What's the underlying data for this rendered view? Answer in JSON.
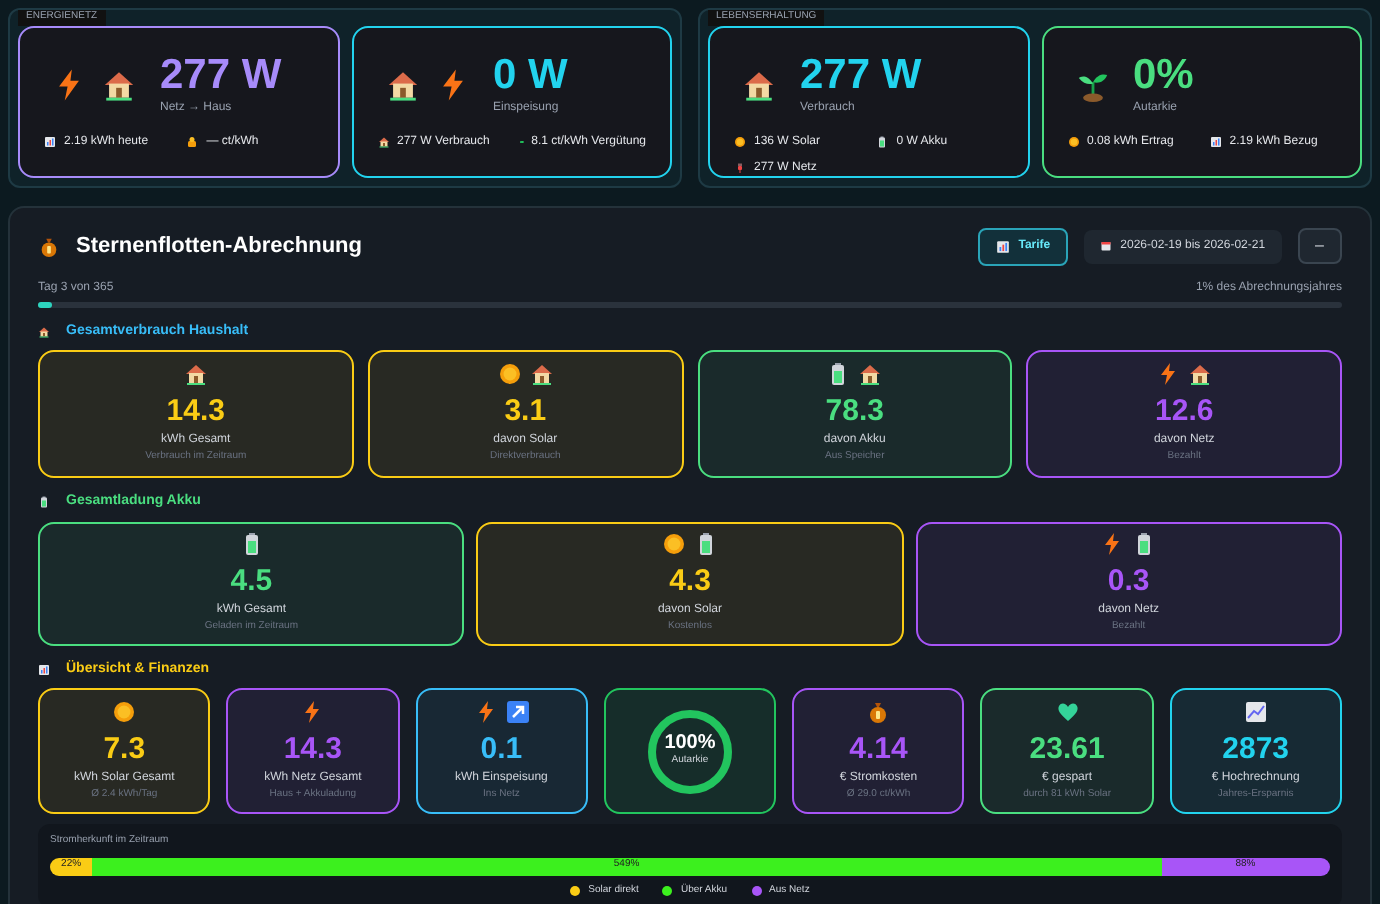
{
  "top_groups": [
    {
      "label": "ENERGIENETZ",
      "cards": [
        {
          "value": "277 W",
          "caption": "Netz → Haus",
          "color": "#a78bfa",
          "stats": [
            "2.19 kWh heute",
            "— ct/kWh"
          ]
        },
        {
          "value": "0 W",
          "caption": "Einspeisung",
          "color": "#22d3ee",
          "stats": [
            "277 W Verbrauch",
            "8.1 ct/kWh Vergütung"
          ]
        }
      ]
    },
    {
      "label": "LEBENSERHALTUNG",
      "cards": [
        {
          "value": "277 W",
          "caption": "Verbrauch",
          "color": "#22d3ee",
          "stats": [
            "136 W Solar",
            "0 W Akku",
            "277 W Netz"
          ]
        },
        {
          "value": "0%",
          "caption": "Autarkie",
          "color": "#4ade80",
          "stats": [
            "0.08 kWh Ertrag",
            "2.19 kWh Bezug"
          ]
        }
      ]
    }
  ],
  "billing": {
    "title": "Sternenflotten-Abrechnung",
    "tariff_button": "Tarife",
    "date_range": "2026-02-19 bis 2026-02-21",
    "collapse_button": "–",
    "progress": {
      "left": "Tag 3 von 365",
      "right": "1% des Abrechnungsjahres",
      "level": 0.01
    },
    "sections": [
      {
        "title": "Gesamtverbrauch Haushalt",
        "color": "#38bdf8",
        "cards": [
          {
            "kind": "stat",
            "value": "14.3",
            "label": "kWh Gesamt",
            "sub": "Verbrauch im Zeitraum",
            "color": "#facc15"
          },
          {
            "kind": "stat",
            "value": "3.1",
            "label": "davon Solar",
            "sub": "Direktverbrauch",
            "color": "#facc15"
          },
          {
            "kind": "stat",
            "value": "78.3",
            "label": "davon Akku",
            "sub": "Aus Speicher",
            "color": "#4ade80"
          },
          {
            "kind": "stat",
            "value": "12.6",
            "label": "davon Netz",
            "sub": "Bezahlt",
            "color": "#a855f7"
          }
        ]
      },
      {
        "title": "Gesamtladung Akku",
        "color": "#4ade80",
        "cards": [
          {
            "kind": "stat",
            "value": "4.5",
            "label": "kWh Gesamt",
            "sub": "Geladen im Zeitraum",
            "color": "#4ade80"
          },
          {
            "kind": "stat",
            "value": "4.3",
            "label": "davon Solar",
            "sub": "Kostenlos",
            "color": "#facc15"
          },
          {
            "kind": "stat",
            "value": "0.3",
            "label": "davon Netz",
            "sub": "Bezahlt",
            "color": "#a855f7"
          }
        ]
      },
      {
        "title": "Übersicht & Finanzen",
        "color": "#facc15",
        "cards": [
          {
            "kind": "stat",
            "value": "7.3",
            "label": "kWh Solar Gesamt",
            "sub": "Ø 2.4 kWh/Tag",
            "color": "#facc15"
          },
          {
            "kind": "stat",
            "value": "14.3",
            "label": "kWh Netz Gesamt",
            "sub": "Haus + Akkuladung",
            "color": "#a855f7"
          },
          {
            "kind": "stat",
            "value": "0.1",
            "label": "kWh Einspeisung",
            "sub": "Ins Netz",
            "color": "#38bdf8"
          },
          {
            "kind": "ring",
            "value": "100%",
            "label": "Autarkie",
            "color": "#22c55e"
          },
          {
            "kind": "stat",
            "value": "4.14",
            "label": "€ Stromkosten",
            "sub": "Ø 29.0 ct/kWh",
            "color": "#a855f7"
          },
          {
            "kind": "stat",
            "value": "23.61",
            "label": "€ gespart",
            "sub": "durch 81 kWh Solar",
            "color": "#4ade80"
          },
          {
            "kind": "stat",
            "value": "2873",
            "label": "€ Hochrechnung",
            "sub": "Jahres-Ersparnis",
            "color": "#22d3ee"
          }
        ]
      }
    ],
    "origin": {
      "title": "Stromherkunft im Zeitraum",
      "segments": [
        {
          "label": "22%",
          "color": "#facc15"
        },
        {
          "label": "549%",
          "color": "#3cf01e"
        },
        {
          "label": "88%",
          "color": "#a855f7"
        }
      ],
      "legend": [
        {
          "label": "Solar direkt",
          "color": "#facc15"
        },
        {
          "label": "Über Akku",
          "color": "#3cf01e"
        },
        {
          "label": "Aus Netz",
          "color": "#a855f7"
        }
      ]
    }
  }
}
